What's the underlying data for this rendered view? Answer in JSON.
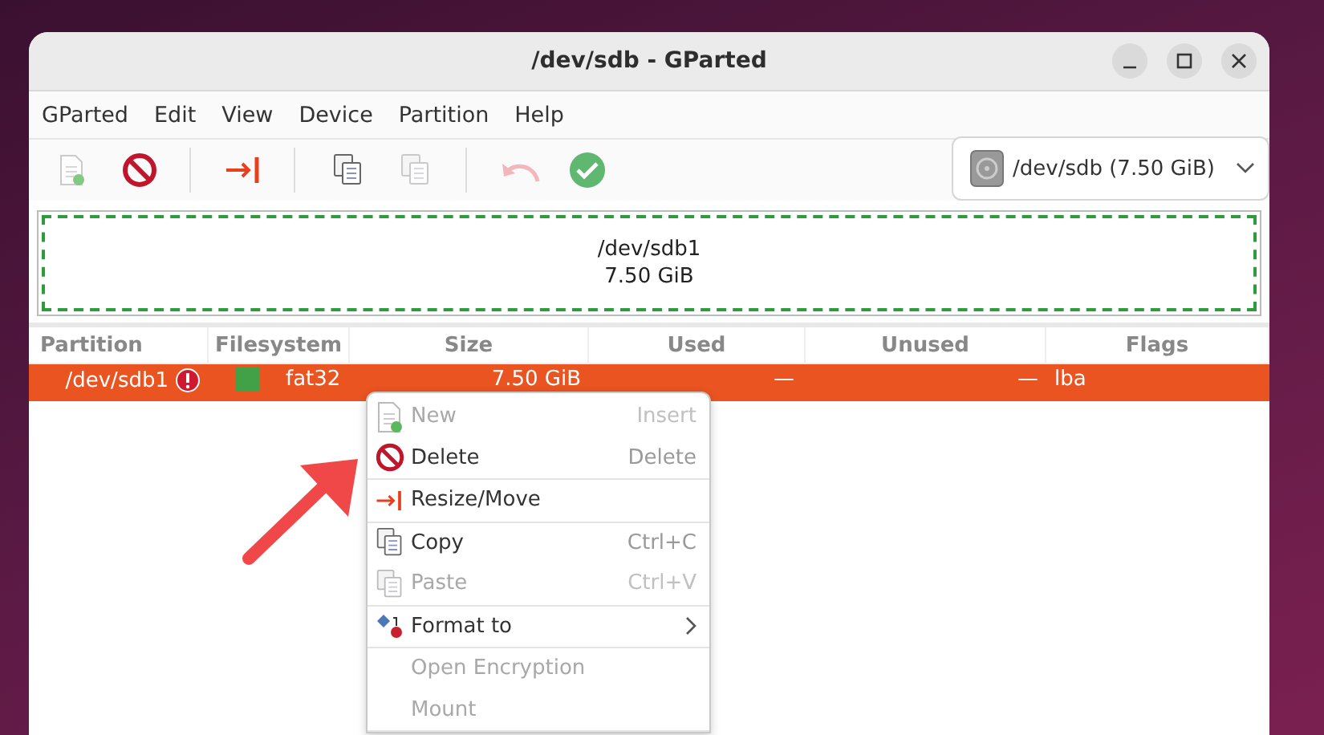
{
  "window": {
    "title": "/dev/sdb - GParted"
  },
  "menubar": [
    "GParted",
    "Edit",
    "View",
    "Device",
    "Partition",
    "Help"
  ],
  "toolbar": [
    {
      "kind": "button",
      "disabled": true
    },
    {
      "kind": "button",
      "disabled": false
    },
    {
      "kind": "separator"
    },
    {
      "kind": "button",
      "disabled": false
    },
    {
      "kind": "separator"
    },
    {
      "kind": "button",
      "disabled": false
    },
    {
      "kind": "button",
      "disabled": true
    },
    {
      "kind": "separator"
    },
    {
      "kind": "button",
      "disabled": true
    },
    {
      "kind": "button",
      "disabled": false
    }
  ],
  "device_selector": {
    "value": "/dev/sdb (7.50 GiB)"
  },
  "disk_map": {
    "partitions": [
      {
        "name": "/dev/sdb1",
        "size": "7.50 GiB",
        "color": "#2c9c3c"
      }
    ]
  },
  "table": {
    "columns": [
      "Partition",
      "Filesystem",
      "Size",
      "Used",
      "Unused",
      "Flags"
    ],
    "rows": [
      {
        "partition": "/dev/sdb1",
        "warning": true,
        "filesystem": "fat32",
        "color": "#42a047",
        "size": "7.50 GiB",
        "used": "—",
        "unused": "—",
        "flags": "lba",
        "selected": true
      }
    ]
  },
  "context_menu": [
    {
      "kind": "item",
      "label": "New",
      "shortcut": "Insert",
      "disabled": true
    },
    {
      "kind": "item",
      "label": "Delete",
      "shortcut": "Delete",
      "disabled": false
    },
    {
      "kind": "separator"
    },
    {
      "kind": "item",
      "label": "Resize/Move",
      "disabled": false
    },
    {
      "kind": "separator"
    },
    {
      "kind": "item",
      "label": "Copy",
      "shortcut": "Ctrl+C",
      "disabled": false
    },
    {
      "kind": "item",
      "label": "Paste",
      "shortcut": "Ctrl+V",
      "disabled": true
    },
    {
      "kind": "separator"
    },
    {
      "kind": "submenu",
      "label": "Format to",
      "disabled": false
    },
    {
      "kind": "separator"
    },
    {
      "kind": "item",
      "label": "Open Encryption",
      "disabled": true
    },
    {
      "kind": "item",
      "label": "Mount",
      "disabled": true
    },
    {
      "kind": "separator"
    }
  ]
}
